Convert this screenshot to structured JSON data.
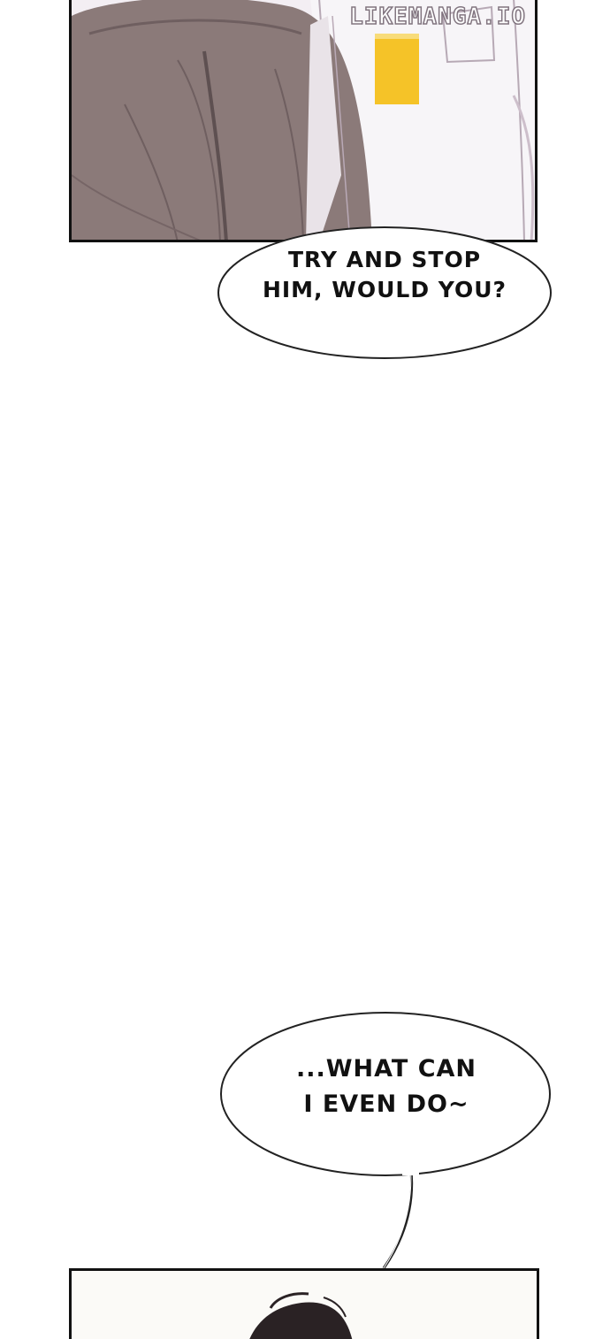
{
  "watermark": "LIKEMANGA.IO",
  "bubble_1": {
    "line_1": "TRY AND STOP",
    "line_2": "HIM, WOULD YOU?"
  },
  "bubble_2": {
    "line_1": "...WHAT CAN",
    "line_2": "I EVEN DO~"
  },
  "colors": {
    "coat_brown": "#8b7a79",
    "coat_shadow": "#6f5f60",
    "shirt_white": "#f5f3f6",
    "badge_yellow": "#f5c328",
    "panel_border": "#111111"
  }
}
